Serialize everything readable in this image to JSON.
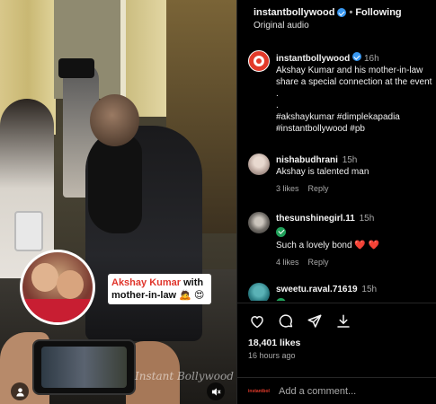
{
  "video": {
    "caption_red": "Akshay Kumar",
    "caption_black_1": " with",
    "caption_black_2": "mother-in-law",
    "caption_emojis": " 🙇 😍",
    "watermark": "Instant Bollywood"
  },
  "header": {
    "username": "instantbollywood",
    "separator": "•",
    "follow_status": "Following",
    "audio": "Original audio"
  },
  "post": {
    "username": "instantbollywood",
    "time": "16h",
    "caption_line_1": "Akshay Kumar and his mother-in-law",
    "caption_line_2": "share a special connection at the event",
    "dot_1": ".",
    "dot_2": ".",
    "hashtags_1": "#akshaykumar #dimplekapadia",
    "hashtags_2": "#instantbollywood #pb"
  },
  "comments": [
    {
      "username": "nishabudhrani",
      "time": "15h",
      "text": "Akshay is talented man",
      "likes": "3 likes",
      "reply": "Reply"
    },
    {
      "username": "thesunshinegirl.11",
      "time": "15h",
      "text": "Such a lovely bond",
      "hearts": "❤️ ❤️",
      "likes": "4 likes",
      "reply": "Reply"
    },
    {
      "username": "sweetu.raval.71619",
      "time": "15h"
    }
  ],
  "stats": {
    "likes": "18,401 likes",
    "ago": "16 hours ago"
  },
  "comment_box": {
    "logo_text": "instantbollywood",
    "placeholder": "Add a comment..."
  },
  "icons": [
    "verified-badge-icon",
    "heart-icon",
    "comment-icon",
    "share-icon",
    "save-icon",
    "user-icon",
    "mute-icon"
  ],
  "colors": {
    "brand_red": "#e23a2a",
    "verified_blue": "#3897f0",
    "heart_red": "#e0303a",
    "background": "#000000"
  }
}
